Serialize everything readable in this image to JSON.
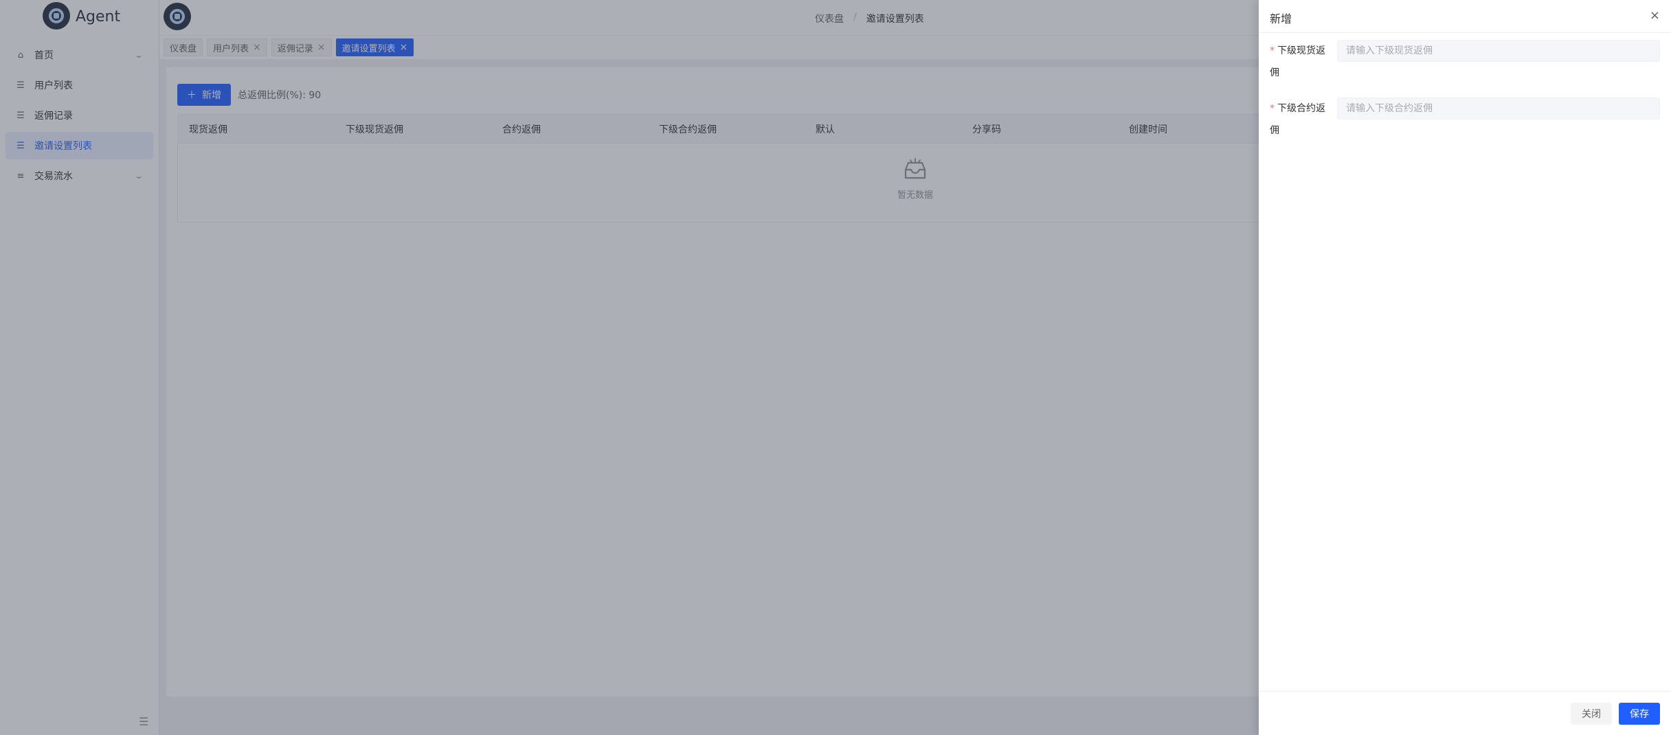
{
  "app": {
    "name": "Agent"
  },
  "sidebar": {
    "items": [
      {
        "label": "首页",
        "icon": "home-icon",
        "has_submenu": true
      },
      {
        "label": "用户列表",
        "icon": "list-icon"
      },
      {
        "label": "返佣记录",
        "icon": "list-icon"
      },
      {
        "label": "邀请设置列表",
        "icon": "list-icon",
        "active": true
      },
      {
        "label": "交易流水",
        "icon": "menu-icon",
        "has_submenu": true
      }
    ]
  },
  "header": {
    "breadcrumb": [
      "仪表盘",
      "邀请设置列表"
    ],
    "separator": "/"
  },
  "tags": [
    {
      "label": "仪表盘",
      "closable": false
    },
    {
      "label": "用户列表",
      "closable": true
    },
    {
      "label": "返佣记录",
      "closable": true
    },
    {
      "label": "邀请设置列表",
      "closable": true,
      "active": true
    }
  ],
  "main": {
    "add_label": "新增",
    "total_label": "总返佣比例(%): 90",
    "table": {
      "columns": [
        "现货返佣",
        "下级现货返佣",
        "合约返佣",
        "下级合约返佣",
        "默认",
        "分享码",
        "创建时间"
      ],
      "rows": [],
      "empty_text": "暂无数据"
    }
  },
  "drawer": {
    "title": "新增",
    "fields": [
      {
        "label": "下级现货返佣",
        "placeholder": "请输入下级现货返佣",
        "value": "",
        "required": true
      },
      {
        "label": "下级合约返佣",
        "placeholder": "请输入下级合约返佣",
        "value": "",
        "required": true
      }
    ],
    "close_label": "关闭",
    "save_label": "保存"
  },
  "colors": {
    "primary": "#1f5fff",
    "required": "#f56c6c"
  }
}
